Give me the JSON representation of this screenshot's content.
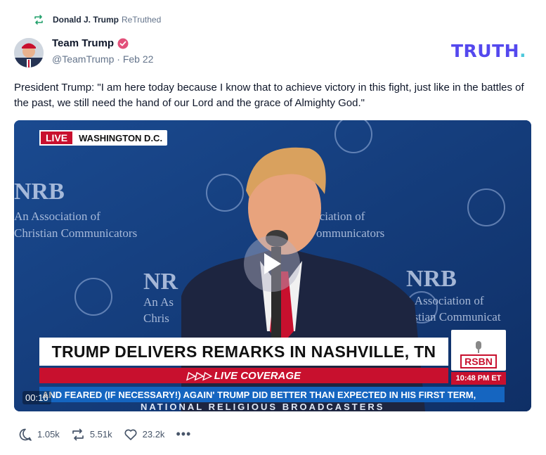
{
  "retruth": {
    "user": "Donald J. Trump",
    "label": "ReTruthed",
    "icon": "retruth-icon"
  },
  "author": {
    "name": "Team Trump",
    "handle": "@TeamTrump",
    "date": "Feb 22",
    "handle_date": "@TeamTrump · Feb 22"
  },
  "brand": {
    "wordmark": "TRUTH",
    "dot": ".",
    "color": "#5448ee",
    "dot_color": "#4ec9dc"
  },
  "post": {
    "text": "President Trump: \"I am here today because I know that to achieve victory in this fight, just like in the battles of the past, we still need the hand of our Lord and the grace of Almighty God.\""
  },
  "video": {
    "live_label": "LIVE",
    "location": "WASHINGTON D.C.",
    "headline": "TRUMP DELIVERS REMARKS IN NASHVILLE, TN",
    "live_coverage": "▷▷▷ LIVE COVERAGE",
    "ticker": "AND FEARED (IF NECESSARY!) AGAIN'   TRUMP DID BETTER THAN EXPECTED IN HIS FIRST TERM,",
    "network": "RSBN",
    "broadcast_time": "10:48 PM ET",
    "bottom_banner": "NATIONAL RELIGIOUS BROADCASTERS",
    "backdrop_logo": "NRB",
    "backdrop_tagline_1": "An Association of",
    "backdrop_tagline_2": "Christian Communicators",
    "timestamp": "00:16"
  },
  "actions": {
    "replies": "1.05k",
    "retruths": "5.51k",
    "likes": "23.2k",
    "more": "•••"
  }
}
